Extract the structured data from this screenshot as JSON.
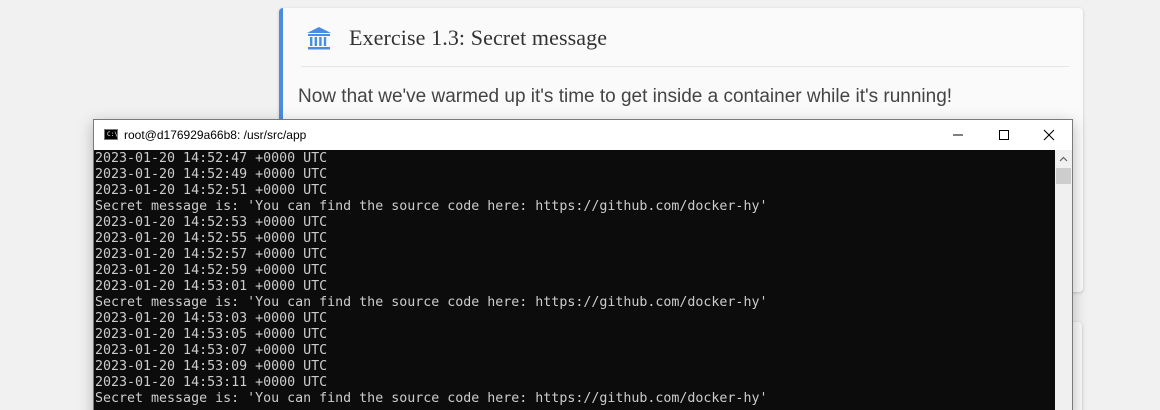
{
  "exercise_card": {
    "title": "Exercise 1.3: Secret message",
    "icon": "institution-icon",
    "body_text": "Now that we've warmed up it's time to get inside a container while it's running!",
    "accent_color": "#4a8de0"
  },
  "console_window": {
    "title": "root@d176929a66b8: /usr/src/app",
    "icon": "console-icon",
    "icon_glyph": "C:\\",
    "controls": {
      "minimize": "minimize-icon",
      "maximize": "maximize-icon",
      "close": "close-icon"
    },
    "background_color": "#0c0c0c",
    "text_color": "#cccccc",
    "lines": [
      "2023-01-20 14:52:47 +0000 UTC",
      "2023-01-20 14:52:49 +0000 UTC",
      "2023-01-20 14:52:51 +0000 UTC",
      "Secret message is: 'You can find the source code here: https://github.com/docker-hy'",
      "2023-01-20 14:52:53 +0000 UTC",
      "2023-01-20 14:52:55 +0000 UTC",
      "2023-01-20 14:52:57 +0000 UTC",
      "2023-01-20 14:52:59 +0000 UTC",
      "2023-01-20 14:53:01 +0000 UTC",
      "Secret message is: 'You can find the source code here: https://github.com/docker-hy'",
      "2023-01-20 14:53:03 +0000 UTC",
      "2023-01-20 14:53:05 +0000 UTC",
      "2023-01-20 14:53:07 +0000 UTC",
      "2023-01-20 14:53:09 +0000 UTC",
      "2023-01-20 14:53:11 +0000 UTC",
      "Secret message is: 'You can find the source code here: https://github.com/docker-hy'"
    ]
  }
}
